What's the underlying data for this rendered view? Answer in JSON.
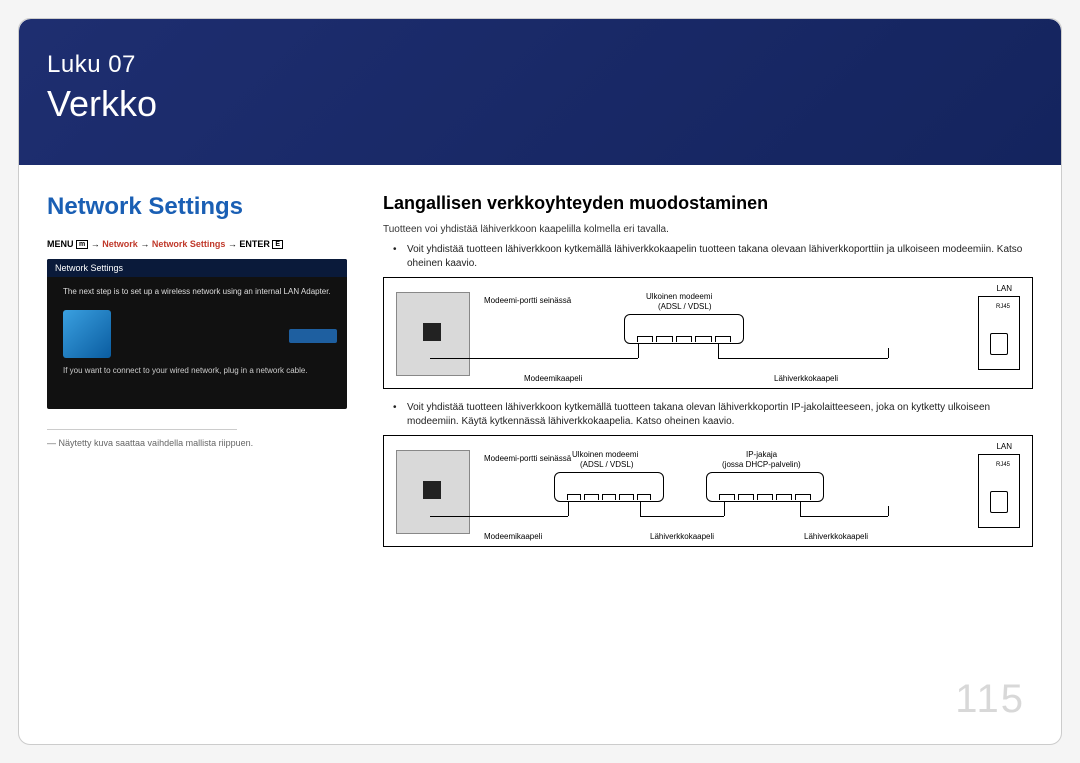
{
  "chapter": {
    "label": "Luku 07",
    "title": "Verkko"
  },
  "page_number": "115",
  "left": {
    "heading": "Network Settings",
    "nav": {
      "menu": "MENU",
      "menu_icon": "m",
      "arrow": "→",
      "p1": "Network",
      "p2": "Network Settings",
      "enter": "ENTER",
      "enter_icon": "E"
    },
    "mock": {
      "title": "Network Settings",
      "line1": "The next step is to set up a wireless network using an internal LAN Adapter.",
      "line2": "If you want to connect to your wired network, plug in a network cable."
    },
    "footnote_prefix": "―",
    "footnote": "Näytetty kuva saattaa vaihdella mallista riippuen."
  },
  "right": {
    "heading": "Langallisen verkkoyhteyden muodostaminen",
    "intro": "Tuotteen voi yhdistää lähiverkkoon kaapelilla kolmella eri tavalla.",
    "bullet1": "Voit yhdistää tuotteen lähiverkkoon kytkemällä lähiverkkokaapelin tuotteen takana olevaan lähiverkkoporttiin ja ulkoiseen modeemiin. Katso oheinen kaavio.",
    "bullet2": "Voit yhdistää tuotteen lähiverkkoon kytkemällä tuotteen takana olevan lähiverkkoportin IP-jakolaitteeseen, joka on kytketty ulkoiseen modeemiin. Käytä kytkennässä lähiverkkokaapelia. Katso oheinen kaavio."
  },
  "diagram_labels": {
    "wall_port": "Modeemi-portti seinässä",
    "ext_modem": "Ulkoinen modeemi",
    "adsl": "(ADSL / VDSL)",
    "ip_sharer": "IP-jakaja",
    "dhcp": "(jossa DHCP-palvelin)",
    "lan": "LAN",
    "rj45": "RJ45",
    "modem_cable": "Modeemikaapeli",
    "lan_cable": "Lähiverkkokaapeli"
  }
}
